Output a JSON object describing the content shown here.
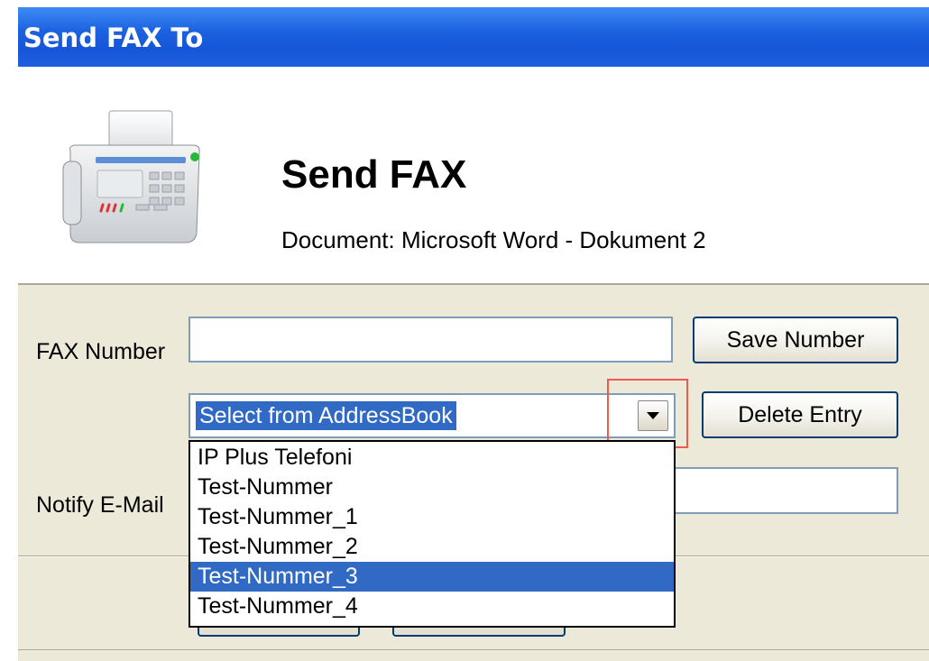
{
  "window": {
    "title": "Send FAX To"
  },
  "header": {
    "heading": "Send FAX",
    "document_line": "Document: Microsoft Word - Dokument 2"
  },
  "form": {
    "fax_number_label": "FAX Number",
    "fax_number_value": "",
    "save_number_label": "Save Number",
    "addressbook_selected": "Select from AddressBook",
    "delete_entry_label": "Delete Entry",
    "notify_email_label": "Notify E-Mail",
    "notify_email_value": ""
  },
  "addressbook_options": [
    {
      "label": "IP Plus Telefoni",
      "selected": false
    },
    {
      "label": "Test-Nummer",
      "selected": false
    },
    {
      "label": "Test-Nummer_1",
      "selected": false
    },
    {
      "label": "Test-Nummer_2",
      "selected": false
    },
    {
      "label": "Test-Nummer_3",
      "selected": true
    },
    {
      "label": "Test-Nummer_4",
      "selected": false
    }
  ],
  "icons": {
    "header_icon": "fax-machine-icon",
    "dropdown_arrow": "chevron-down-icon"
  },
  "colors": {
    "titlebar": "#1C62E0",
    "selection": "#316AC5",
    "dialog_background": "#ECE9D8",
    "highlight_box": "#F05A4A"
  }
}
